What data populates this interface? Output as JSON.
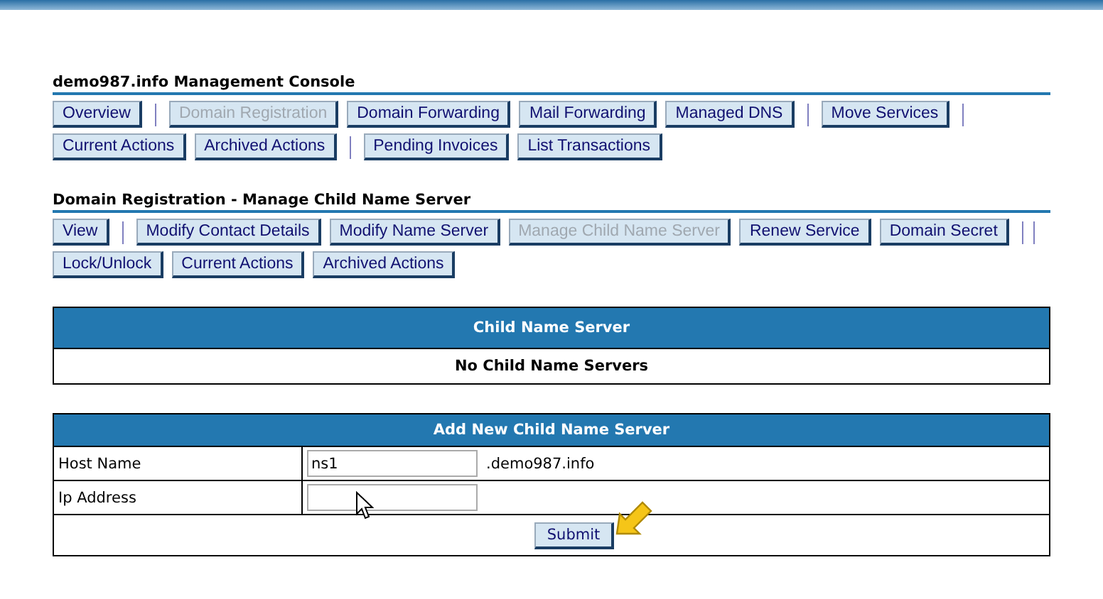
{
  "console": {
    "title": "demo987.info Management Console",
    "buttons": [
      {
        "kind": "button",
        "label": "Overview",
        "disabled": false
      },
      {
        "kind": "separator"
      },
      {
        "kind": "button",
        "label": "Domain Registration",
        "disabled": true
      },
      {
        "kind": "button",
        "label": "Domain Forwarding",
        "disabled": false
      },
      {
        "kind": "button",
        "label": "Mail Forwarding",
        "disabled": false
      },
      {
        "kind": "button",
        "label": "Managed DNS",
        "disabled": false
      },
      {
        "kind": "separator"
      },
      {
        "kind": "button",
        "label": "Move Services",
        "disabled": false
      },
      {
        "kind": "separator"
      },
      {
        "kind": "button",
        "label": "Current Actions",
        "disabled": false
      },
      {
        "kind": "button",
        "label": "Archived Actions",
        "disabled": false
      },
      {
        "kind": "separator"
      },
      {
        "kind": "button",
        "label": "Pending Invoices",
        "disabled": false
      },
      {
        "kind": "button",
        "label": "List Transactions",
        "disabled": false
      }
    ]
  },
  "section": {
    "title": "Domain Registration - Manage Child Name Server",
    "buttons": [
      {
        "kind": "button",
        "label": "View",
        "disabled": false
      },
      {
        "kind": "separator"
      },
      {
        "kind": "button",
        "label": "Modify Contact Details",
        "disabled": false
      },
      {
        "kind": "button",
        "label": "Modify Name Server",
        "disabled": false
      },
      {
        "kind": "button",
        "label": "Manage Child Name Server",
        "disabled": true
      },
      {
        "kind": "button",
        "label": "Renew Service",
        "disabled": false
      },
      {
        "kind": "button",
        "label": "Domain Secret",
        "disabled": false
      },
      {
        "kind": "separator"
      },
      {
        "kind": "separator"
      },
      {
        "kind": "button",
        "label": "Lock/Unlock",
        "disabled": false
      },
      {
        "kind": "button",
        "label": "Current Actions",
        "disabled": false
      },
      {
        "kind": "button",
        "label": "Archived Actions",
        "disabled": false
      }
    ]
  },
  "child_table": {
    "header": "Child Name Server",
    "message": "No Child Name Servers"
  },
  "add_form": {
    "header": "Add New Child Name Server",
    "fields": [
      {
        "label": "Host Name",
        "value": "ns1",
        "suffix": ".demo987.info"
      },
      {
        "label": "Ip Address"
      }
    ],
    "submit": "Submit"
  }
}
